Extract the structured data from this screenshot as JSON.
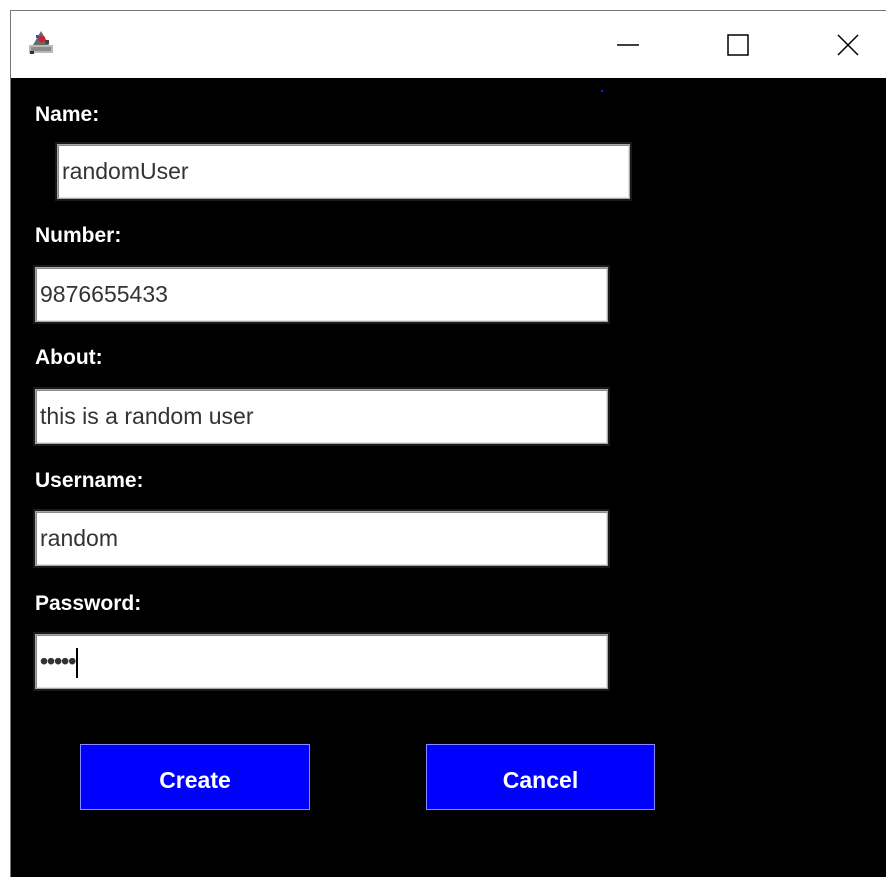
{
  "window": {
    "controls": {
      "minimize_icon": "minimize-icon",
      "maximize_icon": "maximize-icon",
      "close_icon": "close-icon"
    }
  },
  "form": {
    "name": {
      "label": "Name:",
      "value": "randomUser"
    },
    "number": {
      "label": "Number:",
      "value": "9876655433"
    },
    "about": {
      "label": "About:",
      "value": "this is a random user"
    },
    "username": {
      "label": "Username:",
      "value": "random"
    },
    "password": {
      "label": "Password:",
      "masked_value": "•••••"
    }
  },
  "buttons": {
    "create_label": "Create",
    "cancel_label": "Cancel"
  },
  "colors": {
    "background": "#000000",
    "button_fill": "#0000ff",
    "label_text": "#ffffff",
    "field_text": "#333333"
  }
}
